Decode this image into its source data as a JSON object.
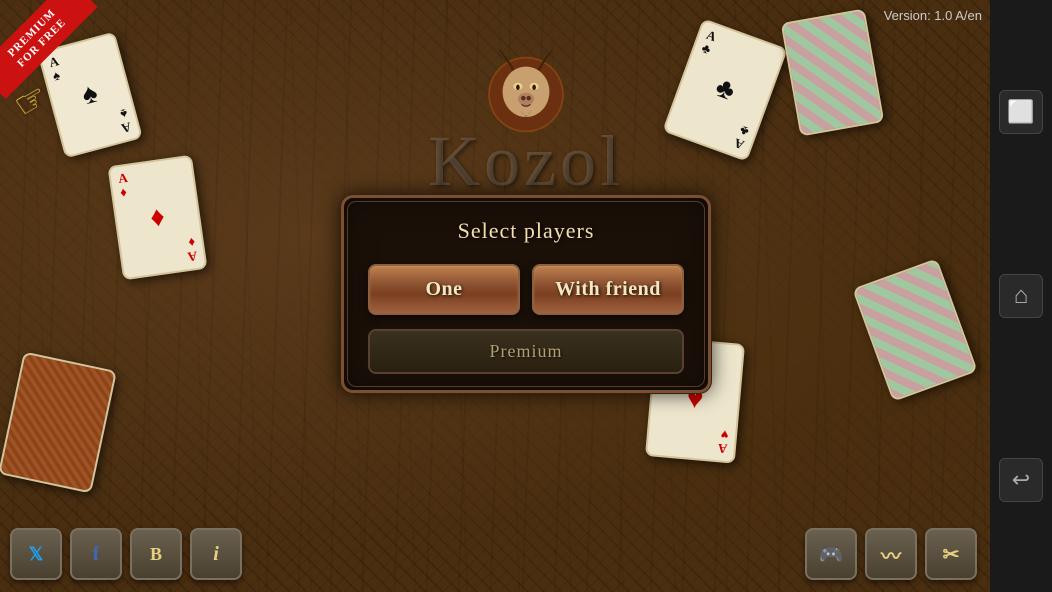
{
  "version": "Version: 1.0 A/en",
  "premium_banner": {
    "line1": "PREMIUM",
    "line2": "FOR FREE"
  },
  "game_title": "Kozol",
  "modal": {
    "title": "Select players",
    "btn_one": "One",
    "btn_friend": "With friend",
    "btn_premium": "Premium"
  },
  "sidebar": {
    "btn_window": "⬜",
    "btn_home": "⌂",
    "btn_back": "↩"
  },
  "bottom_toolbar": {
    "twitter": "𝕏",
    "facebook": "f",
    "blog": "B",
    "info": "i"
  },
  "bottom_right_toolbar": {
    "gamepad": "🎮",
    "waves": "〰",
    "tools": "✂"
  },
  "cards": {
    "card1": {
      "rank": "A",
      "suit": "♠",
      "color": "black"
    },
    "card2": {
      "rank": "A",
      "suit": "♦",
      "color": "red"
    },
    "card4": {
      "rank": "A",
      "suit": "♣",
      "color": "black"
    },
    "card7": {
      "rank": "A",
      "suit": "♥",
      "color": "red"
    }
  }
}
